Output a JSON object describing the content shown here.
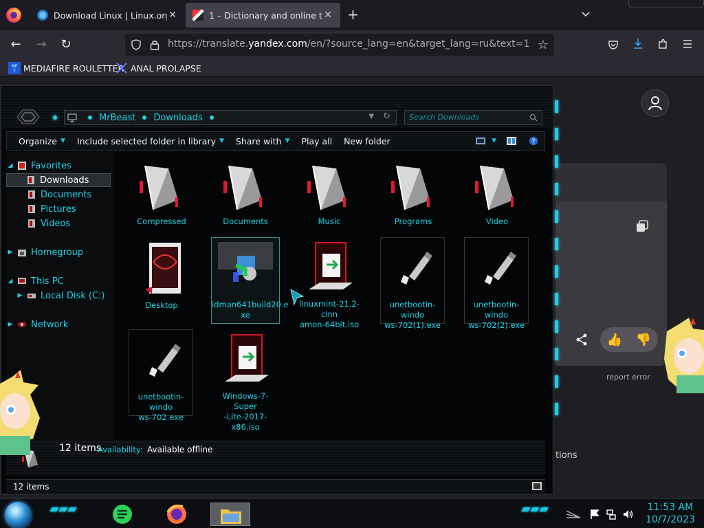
{
  "browser": {
    "tabs": [
      {
        "title": "Download Linux | Linux.org"
      },
      {
        "title": "1 – Dictionary and online transl"
      }
    ],
    "url": {
      "prefix": "https://translate.",
      "host": "yandex.com",
      "rest": "/en/?source_lang=en&target_lang=ru&text=1"
    },
    "bookmarks": [
      {
        "label": "MEDIAFIRE ROULETTER"
      },
      {
        "label": "ANAL PROLAPSE"
      }
    ]
  },
  "yandex": {
    "report": "report error",
    "options_partial": "tions"
  },
  "explorer": {
    "breadcrumb": [
      "MrBeast",
      "Downloads"
    ],
    "search_placeholder": "Search Downloads",
    "toolbar": {
      "organize": "Organize",
      "include": "Include selected folder in library",
      "share": "Share with",
      "play": "Play all",
      "new_folder": "New folder"
    },
    "nav": {
      "favorites": "Favorites",
      "downloads": "Downloads",
      "documents": "Documents",
      "pictures": "Pictures",
      "videos": "Videos",
      "homegroup": "Homegroup",
      "this_pc": "This PC",
      "local_disk": "Local Disk (C:)",
      "network": "Network"
    },
    "items": [
      {
        "name": "Compressed"
      },
      {
        "name": "Documents"
      },
      {
        "name": "Music"
      },
      {
        "name": "Programs"
      },
      {
        "name": "Video"
      },
      {
        "name": "Desktop"
      },
      {
        "name1": "idman641build20.e",
        "name2": "xe"
      },
      {
        "name1": "linuxmint-21.2-cinn",
        "name2": "amon-64bit.iso"
      },
      {
        "name1": "unetbootin-windo",
        "name2": "ws-702(1).exe"
      },
      {
        "name1": "unetbootin-windo",
        "name2": "ws-702(2).exe"
      },
      {
        "name1": "unetbootin-windo",
        "name2": "ws-702.exe"
      },
      {
        "name1": "Windows-7-Super",
        "name2": "-Lite-2017-x86.iso"
      }
    ],
    "details": {
      "count": "12 items",
      "availability_label": "Availability:",
      "availability_value": "Available offline"
    },
    "status": "12 items"
  },
  "taskbar": {
    "time": "11:53 AM",
    "date": "10/7/2023"
  },
  "colors": {
    "accent": "#1ed2e8",
    "ff_bg": "#1c1b22",
    "toolbar": "#2b2a33"
  }
}
